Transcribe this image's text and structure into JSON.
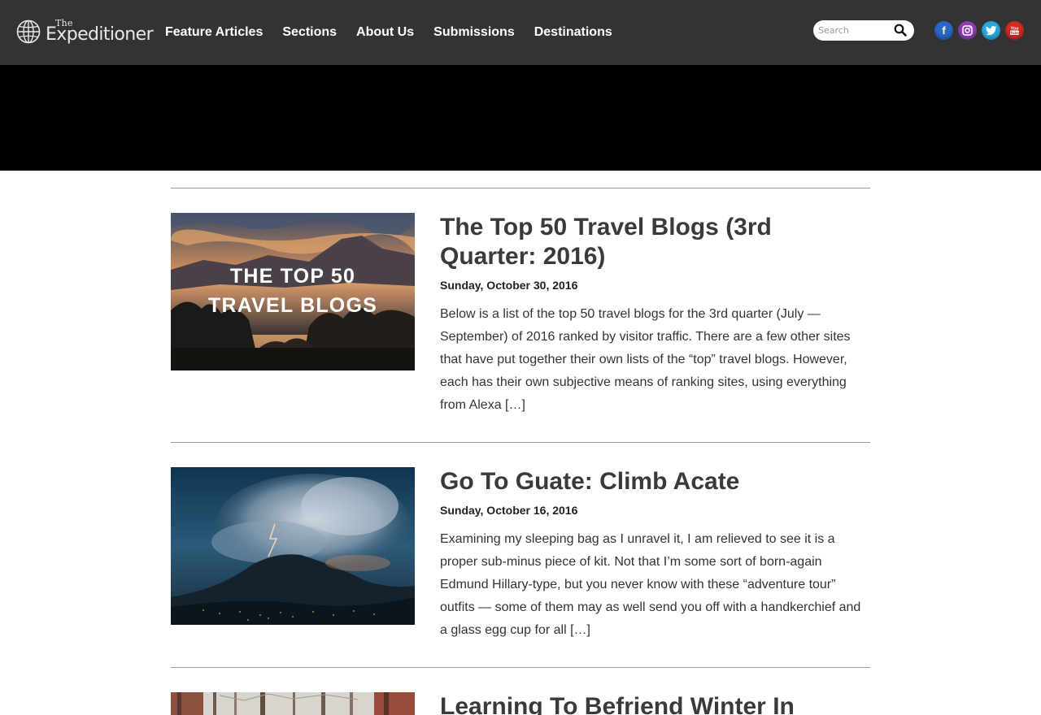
{
  "header": {
    "logo": {
      "prefix": "The",
      "name": "Expeditioner"
    },
    "nav": [
      "Feature Articles",
      "Sections",
      "About Us",
      "Submissions",
      "Destinations"
    ],
    "search": {
      "placeholder": "Search",
      "value": ""
    },
    "social": [
      {
        "name": "facebook",
        "glyph": "f",
        "color": "#2a68c8"
      },
      {
        "name": "instagram",
        "glyph": "◎",
        "color": "#8c3fb5"
      },
      {
        "name": "twitter",
        "glyph": "t",
        "color": "#2aa9e0"
      },
      {
        "name": "youtube",
        "glyph": "▶",
        "color": "#d42a22"
      }
    ]
  },
  "articles": [
    {
      "title": "The Top 50 Travel Blogs (3rd Quarter: 2016)",
      "date": "Sunday, October 30, 2016",
      "excerpt": "Below is a list of the top 50 travel blogs for the 3rd quarter (July — September) of 2016 ranked by visitor traffic. There are a few other sites that have put together their own lists of the “top” travel blogs. However, each has their own subjective means of ranking sites, using everything from Alexa […]",
      "image_caption": [
        "THE TOP 50",
        "TRAVEL BLOGS"
      ]
    },
    {
      "title": "Go To Guate: Climb Acate",
      "date": "Sunday, October 16, 2016",
      "excerpt": "Examining my sleeping bag as I unravel it, I am relieved to see it is a proper sub-minus piece of kit. Not that I’m some sort of born-again Edmund Hillary-type, but you never know with these “adventure tour” outfits — some of them may as well send you off with a handkerchief and a glass egg cup for all […]"
    },
    {
      "title": "Learning To Befriend Winter In"
    }
  ]
}
